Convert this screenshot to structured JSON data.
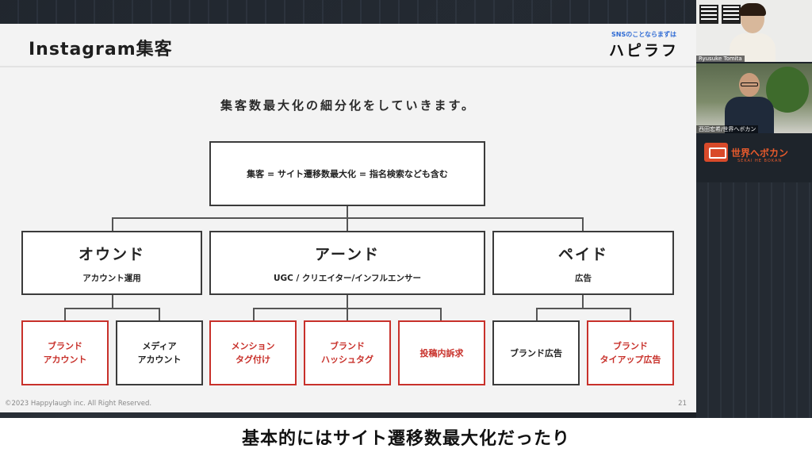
{
  "slide": {
    "title": "Instagram集客",
    "brand_tagline": "SNSのことならまずは",
    "brand_name": "ハピラフ",
    "subtitle": "集客数最大化の細分化をしていきます。",
    "copyright": "©2023 Happylaugh inc. All Right Reserved.",
    "page_number": "21"
  },
  "diagram": {
    "root": "集客 = サイト遷移数最大化 = 指名検索なども含む",
    "categories": [
      {
        "title": "オウンド",
        "desc": "アカウント運用"
      },
      {
        "title": "アーンド",
        "desc": "UGC / クリエイター/インフルエンサー"
      },
      {
        "title": "ペイド",
        "desc": "広告"
      }
    ],
    "leaves": [
      {
        "line1": "ブランド",
        "line2": "アカウント",
        "color": "#c8312b"
      },
      {
        "line1": "メディア",
        "line2": "アカウント",
        "color": "#222222"
      },
      {
        "line1": "メンション",
        "line2": "タグ付け",
        "color": "#c8312b"
      },
      {
        "line1": "ブランド",
        "line2": "ハッシュタグ",
        "color": "#c8312b"
      },
      {
        "line1": "投稿内訴求",
        "line2": "",
        "color": "#c8312b"
      },
      {
        "line1": "ブランド広告",
        "line2": "",
        "color": "#222222"
      },
      {
        "line1": "ブランド",
        "line2": "タイアップ広告",
        "color": "#c8312b"
      }
    ]
  },
  "participants": {
    "cam1_label": "Ryusuke Tomita",
    "cam2_label": "西田宏希/世界へボカン"
  },
  "right_logo": {
    "name": "世界へボカン",
    "sub": "SEKAI HE BOKAN"
  },
  "caption": "基本的にはサイト遷移数最大化だったり"
}
